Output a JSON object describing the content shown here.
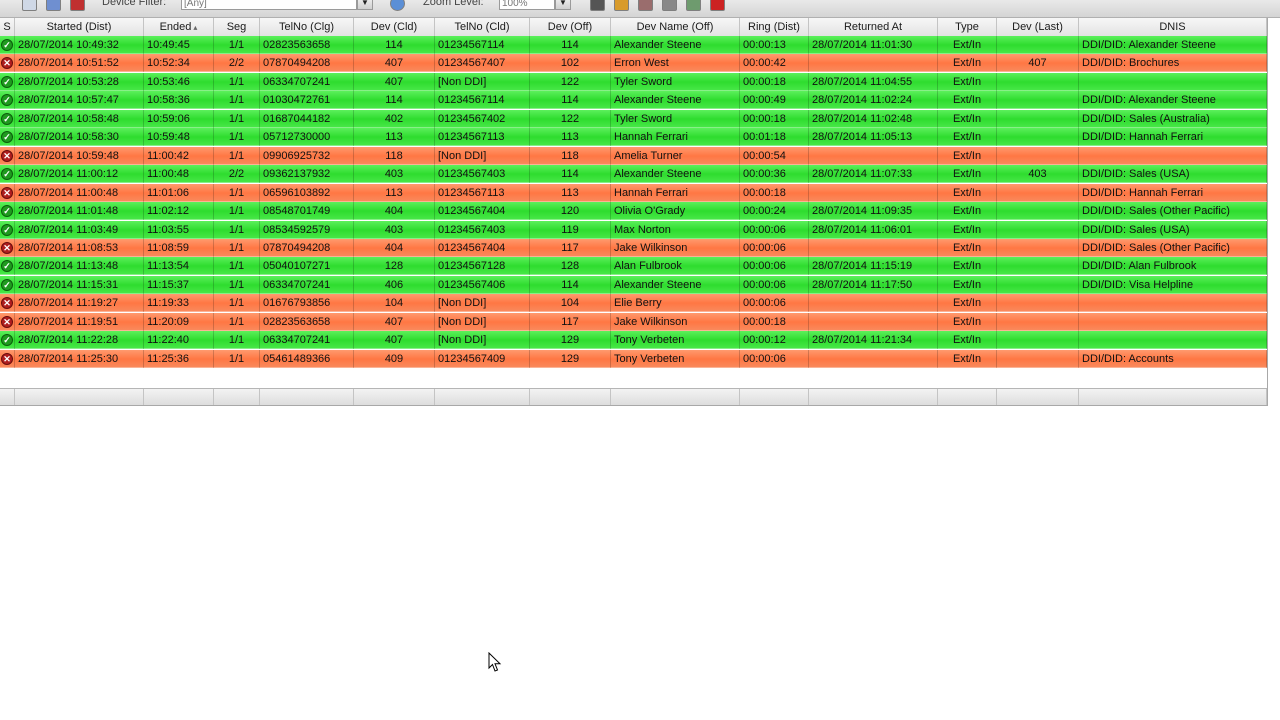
{
  "toolbar": {
    "device_filter_label": "Device Filter:",
    "device_filter_value": "[Any]",
    "zoom_label": "Zoom Level:",
    "zoom_value": "100%",
    "icons": [
      "print-icon",
      "export-icon",
      "filter-icon",
      "refresh-icon",
      "report-icon",
      "color-icon",
      "settings-icon",
      "grid-icon",
      "close-icon"
    ]
  },
  "columns": [
    "S",
    "Started (Dist)",
    "Ended",
    "Seg",
    "TelNo (Clg)",
    "Dev (Cld)",
    "TelNo (Cld)",
    "Dev (Off)",
    "Dev Name (Off)",
    "Ring (Dist)",
    "Returned At",
    "Type",
    "Dev (Last)",
    "DNIS"
  ],
  "sort_indicator": "▴",
  "status_colors": {
    "answered": "#2fdc2f",
    "missed": "#ff7744"
  },
  "rows": [
    {
      "status": "answered",
      "started": "28/07/2014 10:49:32",
      "ended": "10:49:45",
      "seg": "1/1",
      "telno_clg": "02823563658",
      "dev_cld": "114",
      "telno_cld": "01234567114",
      "dev_off": "114",
      "dev_name": "Alexander Steene",
      "ring": "00:00:13",
      "returned_at": "28/07/2014 11:01:30",
      "type": "Ext/In",
      "dev_last": "",
      "dnis": "DDI/DID: Alexander Steene"
    },
    {
      "status": "missed",
      "started": "28/07/2014 10:51:52",
      "ended": "10:52:34",
      "seg": "2/2",
      "telno_clg": "07870494208",
      "dev_cld": "407",
      "telno_cld": "01234567407",
      "dev_off": "102",
      "dev_name": "Erron West",
      "ring": "00:00:42",
      "returned_at": "",
      "type": "Ext/In",
      "dev_last": "407",
      "dnis": "DDI/DID: Brochures"
    },
    {
      "status": "answered",
      "started": "28/07/2014 10:53:28",
      "ended": "10:53:46",
      "seg": "1/1",
      "telno_clg": "06334707241",
      "dev_cld": "407",
      "telno_cld": "[Non DDI]",
      "dev_off": "122",
      "dev_name": "Tyler Sword",
      "ring": "00:00:18",
      "returned_at": "28/07/2014 11:04:55",
      "type": "Ext/In",
      "dev_last": "",
      "dnis": ""
    },
    {
      "status": "answered",
      "started": "28/07/2014 10:57:47",
      "ended": "10:58:36",
      "seg": "1/1",
      "telno_clg": "01030472761",
      "dev_cld": "114",
      "telno_cld": "01234567114",
      "dev_off": "114",
      "dev_name": "Alexander Steene",
      "ring": "00:00:49",
      "returned_at": "28/07/2014 11:02:24",
      "type": "Ext/In",
      "dev_last": "",
      "dnis": "DDI/DID: Alexander Steene"
    },
    {
      "status": "answered",
      "started": "28/07/2014 10:58:48",
      "ended": "10:59:06",
      "seg": "1/1",
      "telno_clg": "01687044182",
      "dev_cld": "402",
      "telno_cld": "01234567402",
      "dev_off": "122",
      "dev_name": "Tyler Sword",
      "ring": "00:00:18",
      "returned_at": "28/07/2014 11:02:48",
      "type": "Ext/In",
      "dev_last": "",
      "dnis": "DDI/DID: Sales (Australia)"
    },
    {
      "status": "answered",
      "started": "28/07/2014 10:58:30",
      "ended": "10:59:48",
      "seg": "1/1",
      "telno_clg": "05712730000",
      "dev_cld": "113",
      "telno_cld": "01234567113",
      "dev_off": "113",
      "dev_name": "Hannah Ferrari",
      "ring": "00:01:18",
      "returned_at": "28/07/2014 11:05:13",
      "type": "Ext/In",
      "dev_last": "",
      "dnis": "DDI/DID: Hannah Ferrari"
    },
    {
      "status": "missed",
      "started": "28/07/2014 10:59:48",
      "ended": "11:00:42",
      "seg": "1/1",
      "telno_clg": "09906925732",
      "dev_cld": "118",
      "telno_cld": "[Non DDI]",
      "dev_off": "118",
      "dev_name": "Amelia Turner",
      "ring": "00:00:54",
      "returned_at": "",
      "type": "Ext/In",
      "dev_last": "",
      "dnis": ""
    },
    {
      "status": "answered",
      "started": "28/07/2014 11:00:12",
      "ended": "11:00:48",
      "seg": "2/2",
      "telno_clg": "09362137932",
      "dev_cld": "403",
      "telno_cld": "01234567403",
      "dev_off": "114",
      "dev_name": "Alexander Steene",
      "ring": "00:00:36",
      "returned_at": "28/07/2014 11:07:33",
      "type": "Ext/In",
      "dev_last": "403",
      "dnis": "DDI/DID: Sales (USA)"
    },
    {
      "status": "missed",
      "started": "28/07/2014 11:00:48",
      "ended": "11:01:06",
      "seg": "1/1",
      "telno_clg": "06596103892",
      "dev_cld": "113",
      "telno_cld": "01234567113",
      "dev_off": "113",
      "dev_name": "Hannah Ferrari",
      "ring": "00:00:18",
      "returned_at": "",
      "type": "Ext/In",
      "dev_last": "",
      "dnis": "DDI/DID: Hannah Ferrari"
    },
    {
      "status": "answered",
      "started": "28/07/2014 11:01:48",
      "ended": "11:02:12",
      "seg": "1/1",
      "telno_clg": "08548701749",
      "dev_cld": "404",
      "telno_cld": "01234567404",
      "dev_off": "120",
      "dev_name": "Olivia O'Grady",
      "ring": "00:00:24",
      "returned_at": "28/07/2014 11:09:35",
      "type": "Ext/In",
      "dev_last": "",
      "dnis": "DDI/DID: Sales (Other Pacific)"
    },
    {
      "status": "answered",
      "started": "28/07/2014 11:03:49",
      "ended": "11:03:55",
      "seg": "1/1",
      "telno_clg": "08534592579",
      "dev_cld": "403",
      "telno_cld": "01234567403",
      "dev_off": "119",
      "dev_name": "Max Norton",
      "ring": "00:00:06",
      "returned_at": "28/07/2014 11:06:01",
      "type": "Ext/In",
      "dev_last": "",
      "dnis": "DDI/DID: Sales (USA)"
    },
    {
      "status": "missed",
      "started": "28/07/2014 11:08:53",
      "ended": "11:08:59",
      "seg": "1/1",
      "telno_clg": "07870494208",
      "dev_cld": "404",
      "telno_cld": "01234567404",
      "dev_off": "117",
      "dev_name": "Jake Wilkinson",
      "ring": "00:00:06",
      "returned_at": "",
      "type": "Ext/In",
      "dev_last": "",
      "dnis": "DDI/DID: Sales (Other Pacific)"
    },
    {
      "status": "answered",
      "started": "28/07/2014 11:13:48",
      "ended": "11:13:54",
      "seg": "1/1",
      "telno_clg": "05040107271",
      "dev_cld": "128",
      "telno_cld": "01234567128",
      "dev_off": "128",
      "dev_name": "Alan Fulbrook",
      "ring": "00:00:06",
      "returned_at": "28/07/2014 11:15:19",
      "type": "Ext/In",
      "dev_last": "",
      "dnis": "DDI/DID: Alan Fulbrook"
    },
    {
      "status": "answered",
      "started": "28/07/2014 11:15:31",
      "ended": "11:15:37",
      "seg": "1/1",
      "telno_clg": "06334707241",
      "dev_cld": "406",
      "telno_cld": "01234567406",
      "dev_off": "114",
      "dev_name": "Alexander Steene",
      "ring": "00:00:06",
      "returned_at": "28/07/2014 11:17:50",
      "type": "Ext/In",
      "dev_last": "",
      "dnis": "DDI/DID: Visa Helpline"
    },
    {
      "status": "missed",
      "started": "28/07/2014 11:19:27",
      "ended": "11:19:33",
      "seg": "1/1",
      "telno_clg": "01676793856",
      "dev_cld": "104",
      "telno_cld": "[Non DDI]",
      "dev_off": "104",
      "dev_name": "Elie Berry",
      "ring": "00:00:06",
      "returned_at": "",
      "type": "Ext/In",
      "dev_last": "",
      "dnis": ""
    },
    {
      "status": "missed",
      "started": "28/07/2014 11:19:51",
      "ended": "11:20:09",
      "seg": "1/1",
      "telno_clg": "02823563658",
      "dev_cld": "407",
      "telno_cld": "[Non DDI]",
      "dev_off": "117",
      "dev_name": "Jake Wilkinson",
      "ring": "00:00:18",
      "returned_at": "",
      "type": "Ext/In",
      "dev_last": "",
      "dnis": ""
    },
    {
      "status": "answered",
      "started": "28/07/2014 11:22:28",
      "ended": "11:22:40",
      "seg": "1/1",
      "telno_clg": "06334707241",
      "dev_cld": "407",
      "telno_cld": "[Non DDI]",
      "dev_off": "129",
      "dev_name": "Tony Verbeten",
      "ring": "00:00:12",
      "returned_at": "28/07/2014 11:21:34",
      "type": "Ext/In",
      "dev_last": "",
      "dnis": ""
    },
    {
      "status": "missed",
      "started": "28/07/2014 11:25:30",
      "ended": "11:25:36",
      "seg": "1/1",
      "telno_clg": "05461489366",
      "dev_cld": "409",
      "telno_cld": "01234567409",
      "dev_off": "129",
      "dev_name": "Tony Verbeten",
      "ring": "00:00:06",
      "returned_at": "",
      "type": "Ext/In",
      "dev_last": "",
      "dnis": "DDI/DID: Accounts"
    }
  ]
}
